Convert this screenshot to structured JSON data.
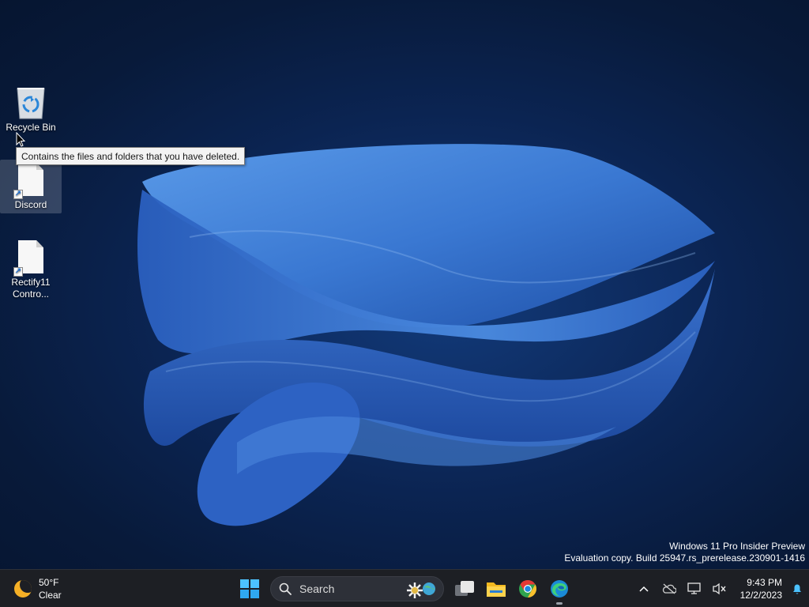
{
  "desktop": {
    "icons": [
      {
        "label": "Recycle Bin"
      },
      {
        "label": "Discord"
      },
      {
        "label": "Rectify11\nContro..."
      }
    ],
    "tooltip": "Contains the files and folders that you have deleted.",
    "watermark": {
      "line1": "Windows 11 Pro Insider Preview",
      "line2": "Evaluation copy. Build 25947.rs_prerelease.230901-1416"
    }
  },
  "taskbar": {
    "weather": {
      "temperature": "50°F",
      "condition": "Clear",
      "icon": "moon-icon"
    },
    "start_icon": "windows-start-icon",
    "search_placeholder": "Search",
    "pinned_apps": [
      "task-view-icon",
      "file-explorer-icon",
      "chrome-icon",
      "edge-icon"
    ],
    "tray": {
      "icons": [
        "chevron-up-icon",
        "onedrive-icon",
        "network-icon",
        "volume-muted-icon",
        "notification-bell-icon"
      ]
    },
    "clock": {
      "time": "9:43 PM",
      "date": "12/2/2023"
    }
  },
  "colors": {
    "wallpaper_bg": "#0b2452",
    "bloom": "#3f7fd6",
    "taskbar": "#1d1f24",
    "accent": "#4cc2ff"
  }
}
